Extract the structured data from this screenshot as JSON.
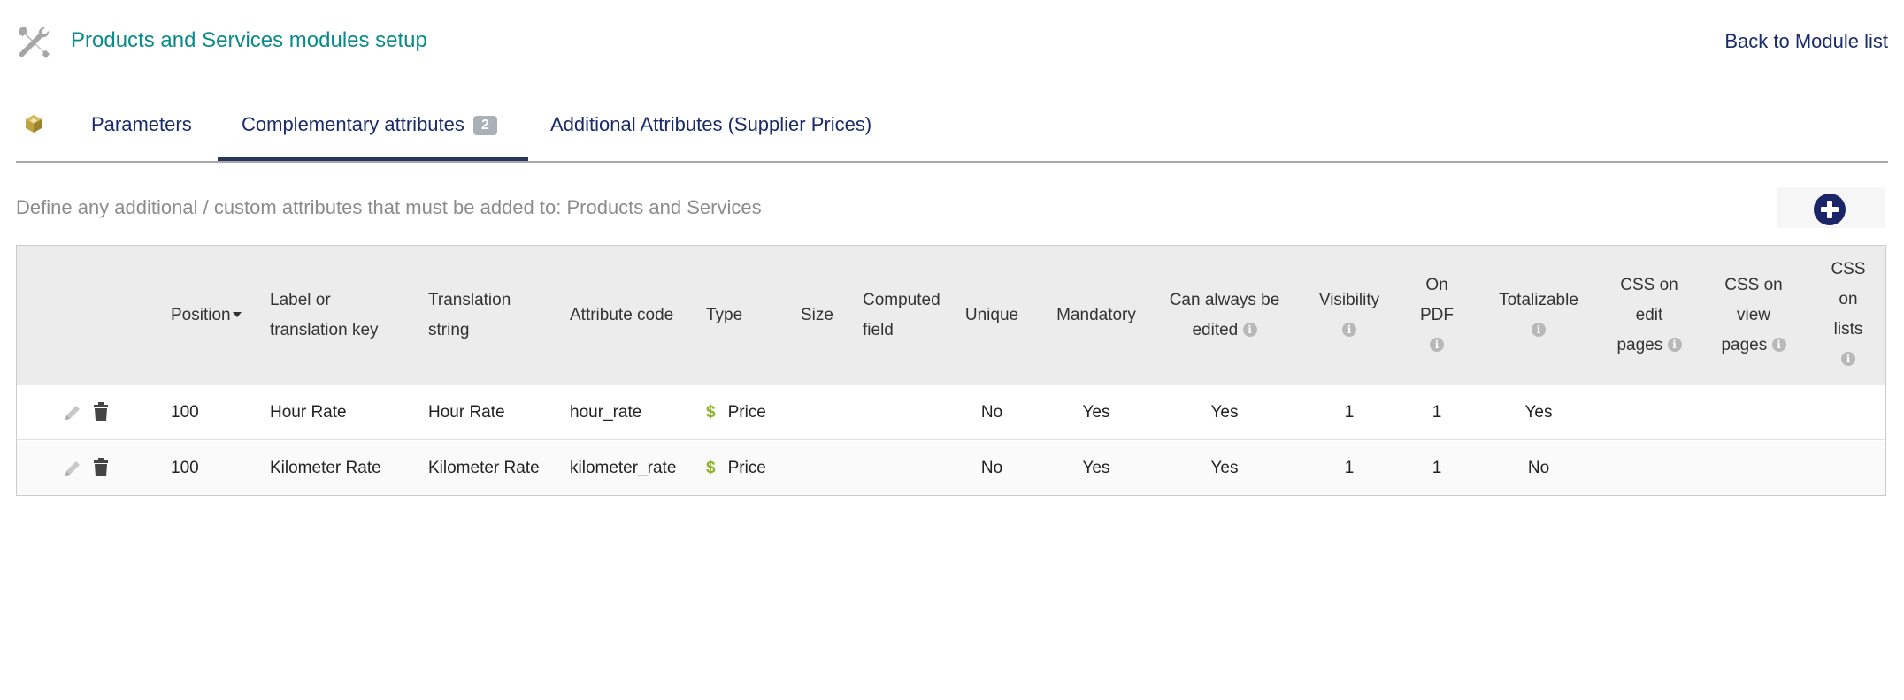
{
  "header": {
    "title": "Products and Services modules setup",
    "back_link": "Back to Module list"
  },
  "tabs": [
    {
      "label": "Parameters"
    },
    {
      "label": "Complementary attributes",
      "badge": "2"
    },
    {
      "label": "Additional Attributes (Supplier Prices)"
    }
  ],
  "description": "Define any additional / custom attributes that must be added to: Products and Services",
  "table": {
    "headers": {
      "position": "Position",
      "label_1": "Label or",
      "label_2": "translation key",
      "translation_1": "Translation",
      "translation_2": "string",
      "attribute_code": "Attribute code",
      "type": "Type",
      "size": "Size",
      "computed_1": "Computed",
      "computed_2": "field",
      "unique": "Unique",
      "mandatory": "Mandatory",
      "can_edit_1": "Can always be",
      "can_edit_2": "edited",
      "visibility": "Visibility",
      "onpdf_1": "On",
      "onpdf_2": "PDF",
      "totalizable": "Totalizable",
      "css_edit_1": "CSS on",
      "css_edit_2": "edit",
      "css_edit_3": "pages",
      "css_view_1": "CSS on",
      "css_view_2": "view",
      "css_view_3": "pages",
      "css_lists_1": "CSS",
      "css_lists_2": "on",
      "css_lists_3": "lists"
    },
    "rows": [
      {
        "position": "100",
        "label": "Hour Rate",
        "translation": "Hour Rate",
        "code": "hour_rate",
        "type_symbol": "$",
        "type": "Price",
        "size": "",
        "computed": "",
        "unique": "No",
        "mandatory": "Yes",
        "can_edit": "Yes",
        "visibility": "1",
        "on_pdf": "1",
        "totalizable": "Yes"
      },
      {
        "position": "100",
        "label": "Kilometer Rate",
        "translation": "Kilometer Rate",
        "code": "kilometer_rate",
        "type_symbol": "$",
        "type": "Price",
        "size": "",
        "computed": "",
        "unique": "No",
        "mandatory": "Yes",
        "can_edit": "Yes",
        "visibility": "1",
        "on_pdf": "1",
        "totalizable": "No"
      }
    ]
  },
  "colors": {
    "title": "#0b8a8a",
    "link": "#1a2b6b",
    "add_button": "#1a2466",
    "price_icon": "#8db327",
    "active_tab_bar": "#26375a"
  },
  "icons": {
    "header": "tools-icon",
    "module": "cube-icon",
    "add": "plus-circle-icon",
    "edit": "pencil-icon",
    "delete": "trash-icon",
    "info": "info-icon",
    "price": "dollar-icon"
  }
}
